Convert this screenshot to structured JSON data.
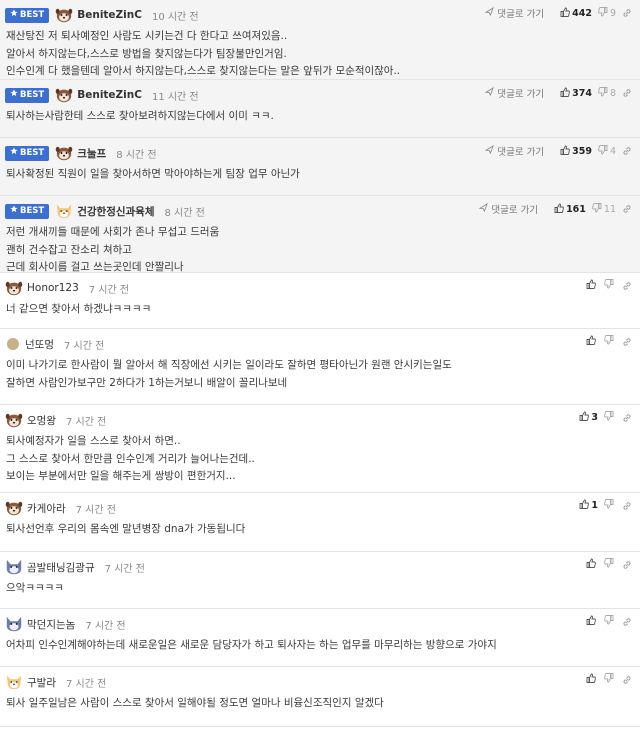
{
  "best_label": "BEST",
  "reply_label": "댓글로 가기",
  "comments": [
    {
      "best": true,
      "user": "BeniteZinC",
      "time": "10 시간 전",
      "up": "442",
      "down": "9",
      "lines": [
        "재산탕진 저 퇴사예정인 사람도 시키는건 다 한다고 쓰여져있음..",
        "알아서 하지않는다,스스로 방법을 찾지않는다가 팀장불만인거임.",
        "인수인계 다 했을텐데 알아서 하지않는다,스스로 찾지않는다는 말은 앞뒤가 모순적이잖아.."
      ]
    },
    {
      "best": true,
      "user": "BeniteZinC",
      "time": "11 시간 전",
      "up": "374",
      "down": "8",
      "lines": [
        "퇴사하는사람한테 스스로 찾아보려하지않는다에서 이미 ㅋㅋ."
      ]
    },
    {
      "best": true,
      "user": "크눌프",
      "time": "8 시간 전",
      "up": "359",
      "down": "4",
      "lines": [
        "퇴사확정된 직원이 일을 찾아서하면 막아야하는게 팀장 업무 아닌가"
      ]
    },
    {
      "best": true,
      "user": "건강한정신과육체",
      "time": "8 시간 전",
      "up": "161",
      "down": "11",
      "lines": [
        "저런 개새끼들 때문에 사회가 존나 무섭고 드러움",
        "괜히 건수잡고 잔소리 쳐하고",
        "근데 회사이름 걸고 쓰는곳인데 안짤리나"
      ]
    },
    {
      "best": false,
      "user": "Honor123",
      "time": "7 시간 전",
      "up": "",
      "down": "",
      "lines": [
        "너 같으면 찾아서 하겠냐ㅋㅋㅋㅋ"
      ]
    },
    {
      "best": false,
      "user": "넌또멍",
      "time": "7 시간 전",
      "up": "",
      "down": "",
      "lines": [
        "이미 나가기로 한사람이 뭘 알아서 해 직장에선 시키는 일이라도 잘하면 평타아닌가 원랜 안시키는일도",
        "잘하면 사람인가보구만 2하다가 1하는거보니 배알이 꼴리나보네"
      ]
    },
    {
      "best": false,
      "user": "오멍왕",
      "time": "7 시간 전",
      "up": "3",
      "down": "",
      "lines": [
        "퇴사예정자가 일을 스스로 찾아서 하면..",
        "그 스스로 찾아서 한만큼 인수인계 거리가 늘어나는건데..",
        "보이는 부분에서만 일을 해주는게 쌍방이 편한거지..."
      ]
    },
    {
      "best": false,
      "user": "카게아라",
      "time": "7 시간 전",
      "up": "1",
      "down": "",
      "lines": [
        "퇴사선언후 우리의 몸속엔 말년병장 dna가 가동됩니다"
      ]
    },
    {
      "best": false,
      "user": "곰발태닝김광규",
      "time": "7 시간 전",
      "up": "",
      "down": "",
      "lines": [
        "으악ㅋㅋㅋㅋ"
      ]
    },
    {
      "best": false,
      "user": "막던지는놈",
      "time": "7 시간 전",
      "up": "",
      "down": "",
      "lines": [
        "어차피 인수인계해야하는데 새로운일은 새로운 담당자가 하고 퇴사자는 하는 업무를 마무리하는 방향으로 가야지"
      ]
    },
    {
      "best": false,
      "user": "구발라",
      "time": "7 시간 전",
      "up": "",
      "down": "",
      "lines": [
        "퇴사 일주일남은 사람이 스스로 찾아서 일해야될 정도면 얼마나 비융신조직인지 알겠다"
      ]
    }
  ]
}
